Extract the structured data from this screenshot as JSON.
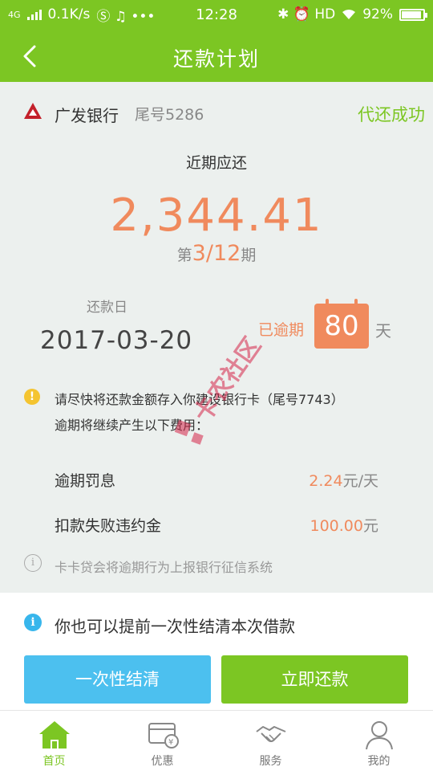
{
  "status_bar": {
    "network": "4G",
    "speed": "0.1K/s",
    "extra_icons": "Ⓢ ♫ •••",
    "time": "12:28",
    "right_icons": "✱ ⏰ HD",
    "battery": "92%",
    "battery_level": 0.92
  },
  "header": {
    "title": "还款计划"
  },
  "bank": {
    "name": "广发银行",
    "tail": "尾号5286",
    "status": "代还成功"
  },
  "repayment": {
    "recent_label": "近期应还",
    "amount": "2,344.41",
    "period_prefix": "第",
    "period_current": "3/12",
    "period_suffix": "期",
    "due_label": "还款日",
    "due_date": "2017-03-20",
    "overdue_label": "已逾期",
    "overdue_days": "80",
    "overdue_unit": "天"
  },
  "warning": {
    "line1": "请尽快将还款金额存入你建设银行卡（尾号7743）",
    "line2": "逾期将继续产生以下费用："
  },
  "fees": [
    {
      "label": "逾期罚息",
      "value": "2.24",
      "unit": "元/天"
    },
    {
      "label": "扣款失败违约金",
      "value": "100.00",
      "unit": "元"
    }
  ],
  "notice": "卡卡贷会将逾期行为上报银行征信系统",
  "watermark_text": "卡农社区",
  "panel": {
    "info_text": "你也可以提前一次性结清本次借款",
    "settle_button": "一次性结清",
    "repay_button": "立即还款"
  },
  "tabs": [
    {
      "label": "首页",
      "icon": "home-icon",
      "active": true
    },
    {
      "label": "优惠",
      "icon": "card-coupon-icon",
      "active": false
    },
    {
      "label": "服务",
      "icon": "handshake-icon",
      "active": false
    },
    {
      "label": "我的",
      "icon": "person-icon",
      "active": false
    }
  ],
  "colors": {
    "brand_green": "#7cc623",
    "accent_orange": "#f08a5d",
    "info_blue": "#38b6ec",
    "warn_yellow": "#f4c430",
    "settle_blue": "#4cc0ef"
  }
}
